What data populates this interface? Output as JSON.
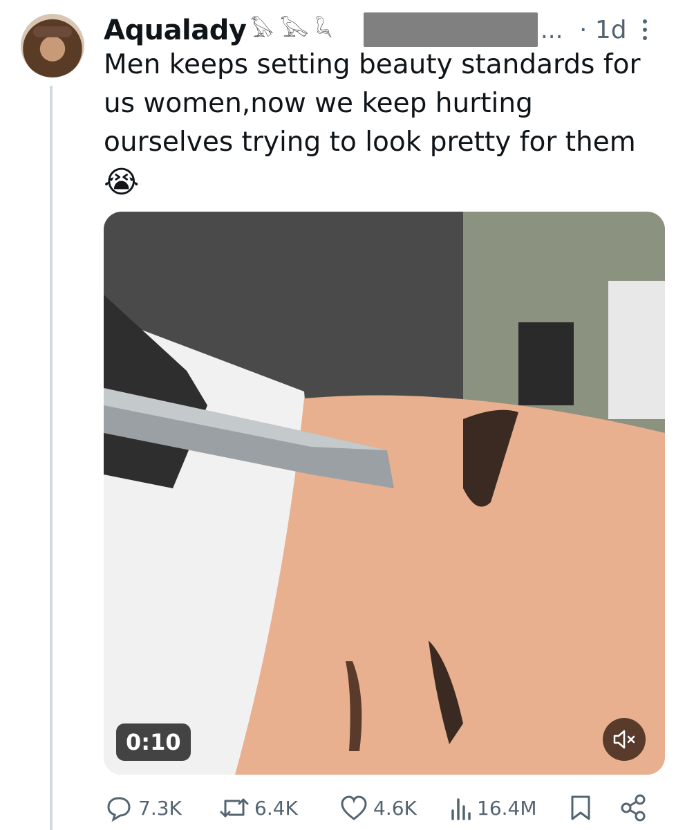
{
  "tweet": {
    "author_name": "Aqualady",
    "author_emojis": "𓅃 𓅂 𓆗",
    "ellipsis": "...",
    "time": "· 1d",
    "text_lines": [
      "Men keeps setting beauty standards for",
      "us women,now we keep hurting",
      "ourselves trying to look pretty for them"
    ],
    "text_emoji": "😭"
  },
  "media": {
    "duration": "0:10",
    "mute_icon": "speaker-muted-icon"
  },
  "actions": {
    "replies": "7.3K",
    "reposts": "6.4K",
    "likes": "4.6K",
    "views": "16.4M"
  },
  "colors": {
    "text": "#0f1419",
    "secondary": "#536471",
    "thread_line": "#cfd9de"
  }
}
